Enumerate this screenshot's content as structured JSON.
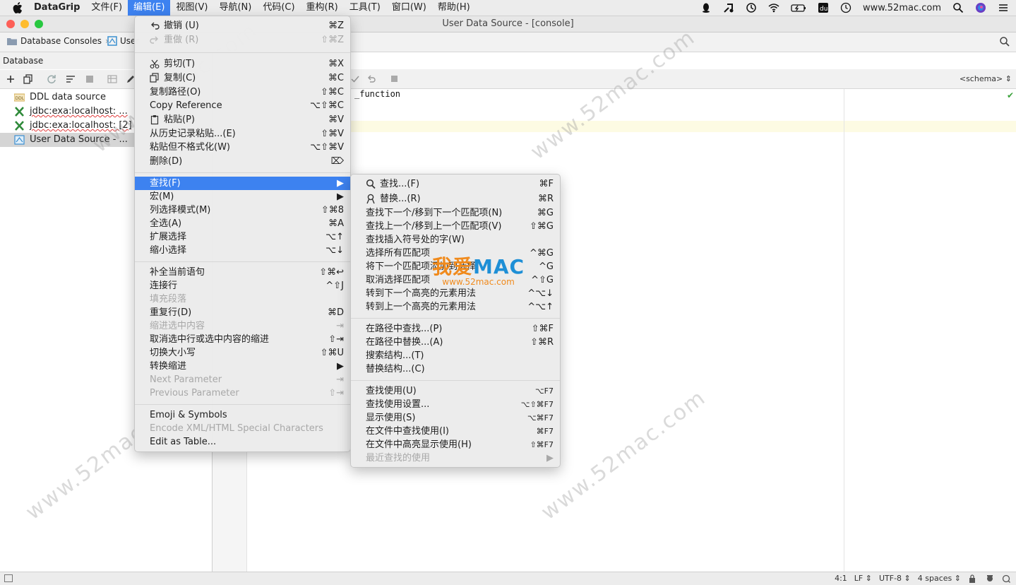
{
  "menubar": {
    "app_name": "DataGrip",
    "items": [
      "文件(F)",
      "编辑(E)",
      "视图(V)",
      "导航(N)",
      "代码(C)",
      "重构(R)",
      "工具(T)",
      "窗口(W)",
      "帮助(H)"
    ],
    "active_item": "编辑(E)",
    "tray_url": "www.52mac.com"
  },
  "window": {
    "title": "User Data Source - [console]"
  },
  "navbar": {
    "breadcrumb_root": "Database Consoles",
    "breadcrumb_current": "User"
  },
  "database_panel": {
    "title": "Database",
    "tree": [
      {
        "label": "DDL data source"
      },
      {
        "label": "jdbc:exa:localhost:  ..."
      },
      {
        "label": "jdbc:exa:localhost: [2]"
      },
      {
        "label": "User Data Source -  ..."
      }
    ]
  },
  "editor": {
    "schema_selector": "<schema>",
    "code_line": "_function"
  },
  "statusbar": {
    "position": "4:1",
    "line_ending": "LF",
    "encoding": "UTF-8",
    "indent": "4 spaces"
  },
  "edit_menu": {
    "items": [
      {
        "label": "撤销 (U)",
        "shortcut": "⌘Z"
      },
      {
        "label": "重做 (R)",
        "shortcut": "⇧⌘Z"
      },
      {
        "label": "剪切(T)",
        "shortcut": "⌘X"
      },
      {
        "label": "复制(C)",
        "shortcut": "⌘C"
      },
      {
        "label": "复制路径(O)",
        "shortcut": "⇧⌘C"
      },
      {
        "label": "Copy Reference",
        "shortcut": "⌥⇧⌘C"
      },
      {
        "label": "粘贴(P)",
        "shortcut": "⌘V"
      },
      {
        "label": "从历史记录粘贴...(E)",
        "shortcut": "⇧⌘V"
      },
      {
        "label": "粘贴但不格式化(W)",
        "shortcut": "⌥⇧⌘V"
      },
      {
        "label": "删除(D)",
        "shortcut": "⌦"
      },
      {
        "label": "查找(F)",
        "shortcut": "▶"
      },
      {
        "label": "宏(M)",
        "shortcut": "▶"
      },
      {
        "label": "列选择模式(M)",
        "shortcut": "⇧⌘8"
      },
      {
        "label": "全选(A)",
        "shortcut": "⌘A"
      },
      {
        "label": "扩展选择",
        "shortcut": "⌥↑"
      },
      {
        "label": "缩小选择",
        "shortcut": "⌥↓"
      },
      {
        "label": "补全当前语句",
        "shortcut": "⇧⌘↩"
      },
      {
        "label": "连接行",
        "shortcut": "^⇧J"
      },
      {
        "label": "填充段落",
        "shortcut": ""
      },
      {
        "label": "重复行(D)",
        "shortcut": "⌘D"
      },
      {
        "label": "缩进选中内容",
        "shortcut": "⇥"
      },
      {
        "label": "取消选中行或选中内容的缩进",
        "shortcut": "⇧⇥"
      },
      {
        "label": "切换大小写",
        "shortcut": "⇧⌘U"
      },
      {
        "label": "转换缩进",
        "shortcut": "▶"
      },
      {
        "label": "Next Parameter",
        "shortcut": "⇥"
      },
      {
        "label": "Previous Parameter",
        "shortcut": "⇧⇥"
      },
      {
        "label": "Emoji & Symbols",
        "shortcut": ""
      },
      {
        "label": "Encode XML/HTML Special Characters",
        "shortcut": ""
      },
      {
        "label": "Edit as Table...",
        "shortcut": ""
      }
    ]
  },
  "find_submenu": {
    "items": [
      {
        "label": "查找...(F)",
        "shortcut": "⌘F"
      },
      {
        "label": "替换...(R)",
        "shortcut": "⌘R"
      },
      {
        "label": "查找下一个/移到下一个匹配项(N)",
        "shortcut": "⌘G"
      },
      {
        "label": "查找上一个/移到上一个匹配项(V)",
        "shortcut": "⇧⌘G"
      },
      {
        "label": "查找插入符号处的字(W)",
        "shortcut": ""
      },
      {
        "label": "选择所有匹配项",
        "shortcut": "^⌘G"
      },
      {
        "label": "将下一个匹配项添加到选择",
        "shortcut": "^G"
      },
      {
        "label": "取消选择匹配项",
        "shortcut": "^⇧G"
      },
      {
        "label": "转到下一个高亮的元素用法",
        "shortcut": "^⌥↓"
      },
      {
        "label": "转到上一个高亮的元素用法",
        "shortcut": "^⌥↑"
      },
      {
        "label": "在路径中查找...(P)",
        "shortcut": "⇧⌘F"
      },
      {
        "label": "在路径中替换...(A)",
        "shortcut": "⇧⌘R"
      },
      {
        "label": "搜索结构...(T)",
        "shortcut": ""
      },
      {
        "label": "替换结构...(C)",
        "shortcut": ""
      },
      {
        "label": "查找使用(U)",
        "shortcut": "⌥F7"
      },
      {
        "label": "查找使用设置...",
        "shortcut": "⌥⇧⌘F7"
      },
      {
        "label": "显示使用(S)",
        "shortcut": "⌥⌘F7"
      },
      {
        "label": "在文件中查找使用(I)",
        "shortcut": "⌘F7"
      },
      {
        "label": "在文件中高亮显示使用(H)",
        "shortcut": "⇧⌘F7"
      },
      {
        "label": "最近查找的使用",
        "shortcut": "▶"
      }
    ]
  },
  "watermark": {
    "text": "www.52mac.com",
    "brand_a": "我爱",
    "brand_b": "MAC",
    "brand_sub": "www.52mac.com"
  }
}
